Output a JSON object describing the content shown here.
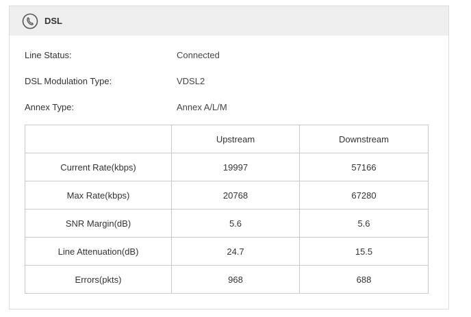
{
  "panel": {
    "title": "DSL",
    "icon": "phone-line-icon"
  },
  "info": [
    {
      "label": "Line Status:",
      "value": "Connected"
    },
    {
      "label": "DSL Modulation Type:",
      "value": "VDSL2"
    },
    {
      "label": "Annex Type:",
      "value": "Annex A/L/M"
    }
  ],
  "table": {
    "headers": [
      "",
      "Upstream",
      "Downstream"
    ],
    "rows": [
      {
        "label": "Current Rate(kbps)",
        "upstream": "19997",
        "downstream": "57166"
      },
      {
        "label": "Max Rate(kbps)",
        "upstream": "20768",
        "downstream": "67280"
      },
      {
        "label": "SNR Margin(dB)",
        "upstream": "5.6",
        "downstream": "5.6"
      },
      {
        "label": "Line Attenuation(dB)",
        "upstream": "24.7",
        "downstream": "15.5"
      },
      {
        "label": "Errors(pkts)",
        "upstream": "968",
        "downstream": "688"
      }
    ]
  }
}
